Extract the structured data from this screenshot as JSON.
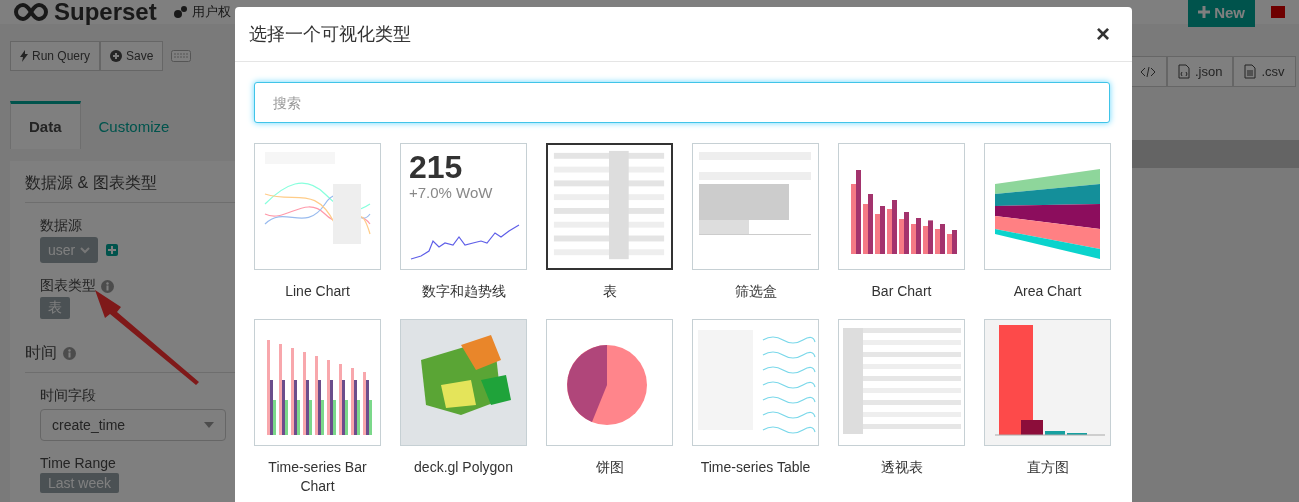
{
  "navbar": {
    "brand": "Superset",
    "items": [
      {
        "label": "用户权"
      }
    ],
    "new_button": "New"
  },
  "toolbar": {
    "buttons": [
      {
        "label": "Run Query",
        "kind": "run"
      },
      {
        "label": "Save",
        "kind": "save"
      }
    ]
  },
  "tabs": [
    {
      "label": "Data",
      "selected": true
    },
    {
      "label": "Customize",
      "selected": false
    }
  ],
  "sections": [
    {
      "title": "数据源 & 图表类型",
      "info": false,
      "fields": [
        {
          "kind": "datasource",
          "label": "数据源",
          "info": false,
          "value": "user"
        },
        {
          "kind": "badge",
          "label": "图表类型",
          "info": true,
          "value": "表"
        }
      ]
    },
    {
      "title": "时间",
      "info": true,
      "fields": [
        {
          "kind": "select",
          "label": "时间字段",
          "info": false,
          "value": "create_time"
        },
        {
          "kind": "badge",
          "label": "Time Range",
          "info": false,
          "value": "Last week"
        }
      ]
    }
  ],
  "export_buttons": [
    {
      "kind": "embed"
    },
    {
      "label": ".json",
      "kind": "json"
    },
    {
      "label": ".csv",
      "kind": "csv"
    }
  ],
  "modal": {
    "title": "选择一个可视化类型",
    "close": "×",
    "search": {
      "placeholder": "搜索"
    },
    "viz_types": [
      {
        "label": "Line Chart",
        "kind": "line",
        "selected": false
      },
      {
        "label": "数字和趋势线",
        "kind": "bignumber",
        "number": "215",
        "delta": "+7.0% WoW",
        "selected": false
      },
      {
        "label": "表",
        "kind": "table",
        "selected": true
      },
      {
        "label": "筛选盒",
        "kind": "filter",
        "selected": false
      },
      {
        "label": "Bar Chart",
        "kind": "bar",
        "selected": false
      },
      {
        "label": "Area Chart",
        "kind": "area",
        "selected": false
      },
      {
        "label": "Time-series Bar Chart",
        "kind": "tsbar",
        "selected": false
      },
      {
        "label": "deck.gl Polygon",
        "kind": "map",
        "selected": false
      },
      {
        "label": "饼图",
        "kind": "pie",
        "selected": false
      },
      {
        "label": "Time-series Table",
        "kind": "tstable",
        "selected": false
      },
      {
        "label": "透视表",
        "kind": "pivot",
        "selected": false
      },
      {
        "label": "直方图",
        "kind": "histogram",
        "selected": false
      }
    ]
  }
}
